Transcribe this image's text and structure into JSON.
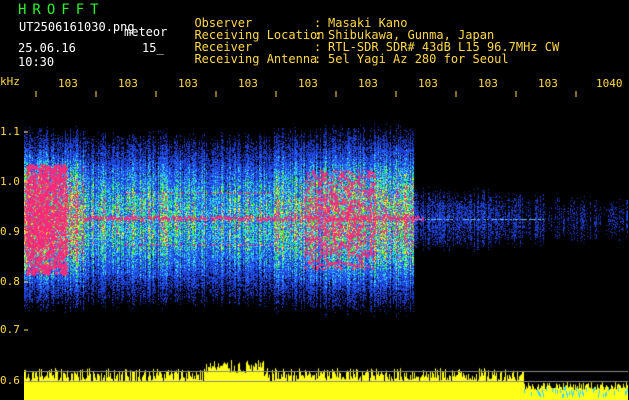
{
  "header": {
    "app_title": "HROFFT",
    "file_name": "UT2506161030.png",
    "mode_label": "meteor",
    "timestamp": "25.06.16 10:30",
    "minute_label": "15_",
    "rows": [
      {
        "label": "Observer",
        "value": "Masaki Kano"
      },
      {
        "label": "Receiving Location",
        "value": "Shibukawa, Gunma, Japan"
      },
      {
        "label": "Receiver",
        "value": "RTL-SDR SDR# 43dB L15 96.7MHz CW"
      },
      {
        "label": "Receiving Antenna",
        "value": "5el Yagi Az 280 for Seoul"
      }
    ]
  },
  "axis": {
    "y_unit": "kHz",
    "y_ticks": [
      "1.1",
      "1.0",
      "0.9",
      "0.8",
      "0.7",
      "0.6"
    ],
    "x_ticks": [
      "103",
      "103",
      "103",
      "103",
      "103",
      "103",
      "103",
      "103",
      "103",
      "1040"
    ]
  },
  "colors": {
    "text_main": "#ffd84a",
    "title_green": "#2cf22c",
    "background": "#000000",
    "spectrum_pink": "#ff2a7a",
    "spectrum_yellow": "#f6f22a",
    "spectrum_cyan": "#34d7ff",
    "spectrum_blue": "#1c3dcc",
    "signal_yellow": "#ffff18"
  }
}
